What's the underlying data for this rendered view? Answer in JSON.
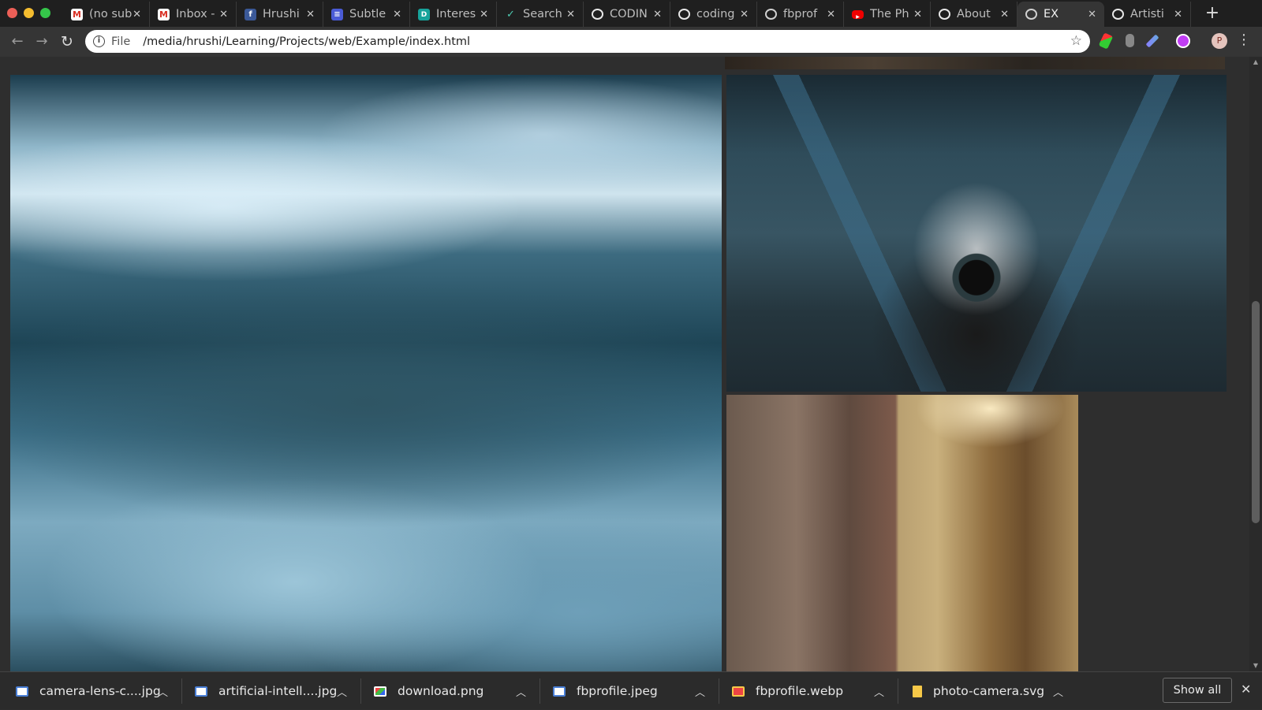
{
  "tabs": [
    {
      "title": "(no sub",
      "icon": "gmail-icon",
      "active": false
    },
    {
      "title": "Inbox -",
      "icon": "gmail-icon",
      "active": false
    },
    {
      "title": "Hrushi",
      "icon": "facebook-icon",
      "active": false
    },
    {
      "title": "Subtle",
      "icon": "subtle-icon",
      "active": false
    },
    {
      "title": "Interes",
      "icon": "dev-icon",
      "active": false
    },
    {
      "title": "Search",
      "icon": "search-check-icon",
      "active": false
    },
    {
      "title": "CODIN",
      "icon": "google-icon",
      "active": false
    },
    {
      "title": "coding",
      "icon": "google-icon",
      "active": false
    },
    {
      "title": "fbprof",
      "icon": "globe-icon",
      "active": false
    },
    {
      "title": "The Ph",
      "icon": "youtube-icon",
      "active": false
    },
    {
      "title": "About",
      "icon": "google-icon",
      "active": false
    },
    {
      "title": "EX",
      "icon": "globe-icon",
      "active": true
    },
    {
      "title": "Artisti",
      "icon": "google-icon",
      "active": false
    }
  ],
  "address_bar": {
    "scheme_label": "File",
    "url": "/media/hrushi/Learning/Projects/web/Example/index.html"
  },
  "downloads": [
    {
      "name": "camera-lens-c....jpg",
      "type": "jpg"
    },
    {
      "name": "artificial-intell....jpg",
      "type": "jpg"
    },
    {
      "name": "download.png",
      "type": "png"
    },
    {
      "name": "fbprofile.jpeg",
      "type": "jpg"
    },
    {
      "name": "fbprofile.webp",
      "type": "webp"
    },
    {
      "name": "photo-camera.svg",
      "type": "svg"
    }
  ],
  "show_all_label": "Show all",
  "avatar_initial": "P",
  "colors": {
    "tabstrip_bg": "#1f1f1f",
    "toolbar_bg": "#353535",
    "page_bg": "#2e2e2e",
    "shelf_bg": "#2b2b2b"
  }
}
